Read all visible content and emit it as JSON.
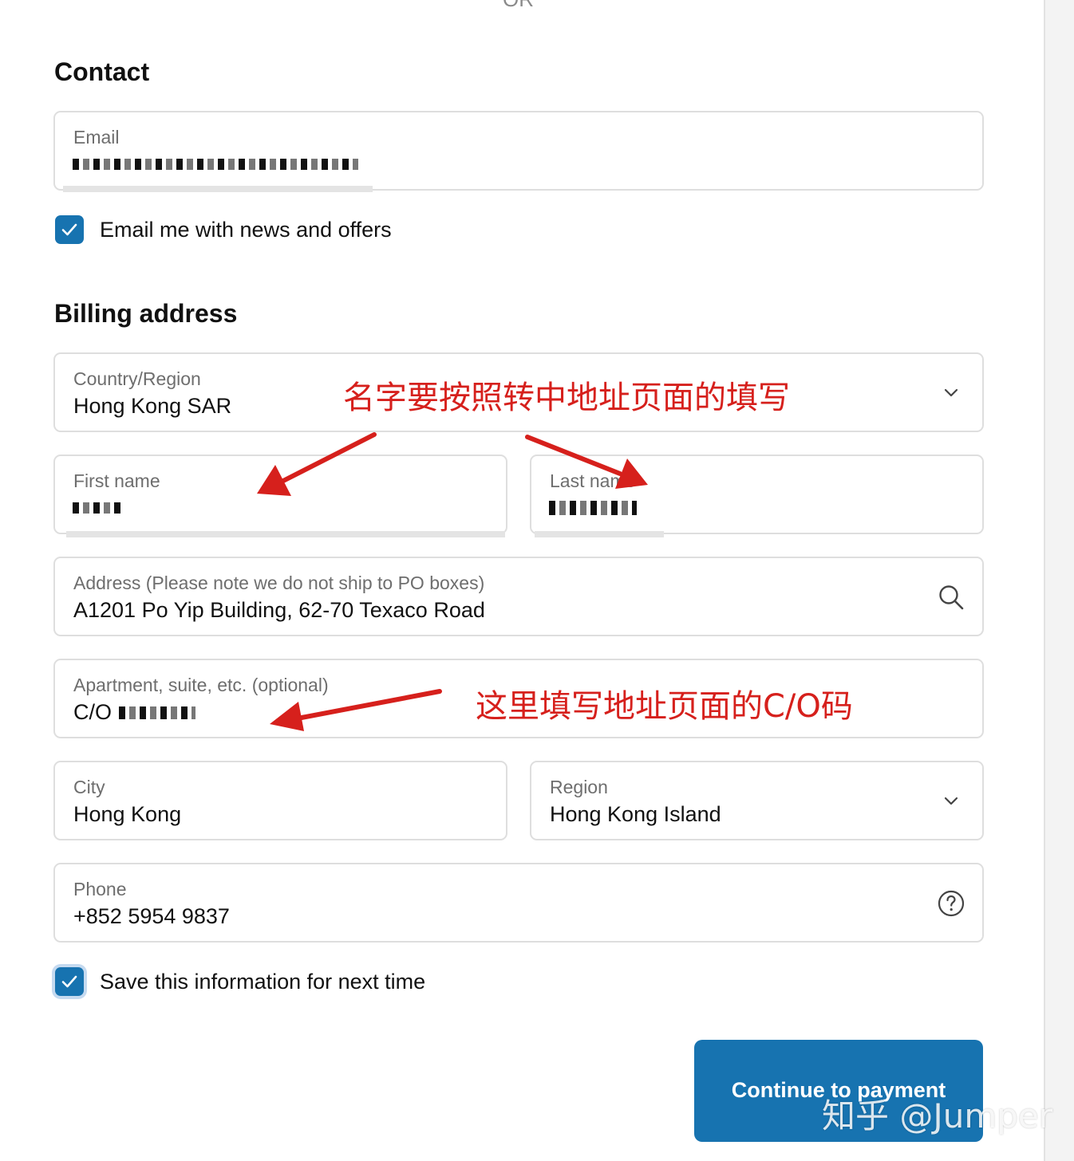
{
  "divider_text": "OR",
  "contact": {
    "heading": "Contact",
    "email": {
      "label": "Email",
      "value": ""
    },
    "newsletter": {
      "label": "Email me with news and offers",
      "checked": true
    }
  },
  "billing": {
    "heading": "Billing address",
    "country": {
      "label": "Country/Region",
      "value": "Hong Kong SAR",
      "icon": "chevron-down-icon"
    },
    "first_name": {
      "label": "First name",
      "value": ""
    },
    "last_name": {
      "label": "Last name",
      "value": ""
    },
    "address": {
      "label": "Address (Please note we do not ship to PO boxes)",
      "value": "A1201 Po Yip Building, 62-70 Texaco Road",
      "icon": "search-icon"
    },
    "apartment": {
      "label": "Apartment, suite, etc. (optional)",
      "value": "C/O"
    },
    "city": {
      "label": "City",
      "value": "Hong Kong"
    },
    "region": {
      "label": "Region",
      "value": "Hong Kong Island",
      "icon": "chevron-down-icon"
    },
    "phone": {
      "label": "Phone",
      "value": "+852 5954 9837",
      "icon": "help-circle-icon"
    },
    "save_info": {
      "label": "Save this information for next time",
      "checked": true
    }
  },
  "actions": {
    "continue_label": "Continue to payment"
  },
  "annotations": {
    "name_note": "名字要按照转中地址页面的填写",
    "co_note": "这里填写地址页面的C/O码",
    "color": "#d6201c"
  },
  "watermark": "知乎 @Jumper",
  "colors": {
    "accent": "#1773b0",
    "border": "#dedede"
  }
}
